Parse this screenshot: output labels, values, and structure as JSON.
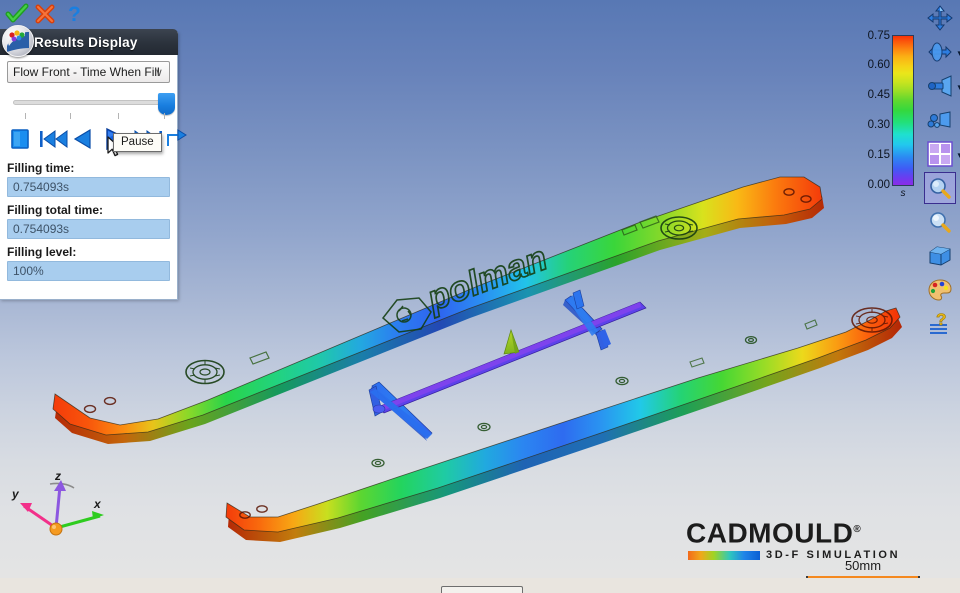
{
  "window": {
    "top_icons": [
      {
        "name": "ok-icon",
        "label": "OK"
      },
      {
        "name": "cancel-icon",
        "label": "Cancel"
      },
      {
        "name": "help-icon",
        "label": "Help"
      }
    ]
  },
  "panel": {
    "title": "Results Display",
    "icon": "results-display-icon",
    "result_type": {
      "selected": "Flow Front - Time When Fill",
      "arrow": "∨"
    },
    "timeline": {
      "position_percent": 100,
      "tick_count": 4
    },
    "playback": [
      {
        "name": "stop-button",
        "label": "Stop"
      },
      {
        "name": "first-frame-button",
        "label": "First"
      },
      {
        "name": "previous-frame-button",
        "label": "Previous"
      },
      {
        "name": "play-button",
        "label": "Play"
      },
      {
        "name": "next-frame-button",
        "label": "Next"
      },
      {
        "name": "loop-button",
        "label": "Loop"
      }
    ],
    "tooltip": "Pause",
    "fields": [
      {
        "label": "Filling time:",
        "value": "0.754093s"
      },
      {
        "label": "Filling total time:",
        "value": "0.754093s"
      },
      {
        "label": "Filling level:",
        "value": "100%"
      }
    ]
  },
  "legend": {
    "unit": "s",
    "ticks": [
      "0.75",
      "0.60",
      "0.45",
      "0.30",
      "0.15",
      "0.00"
    ],
    "min": 0.0,
    "max": 0.75,
    "colors_low_to_high": [
      "#8b2ce8",
      "#2b8cf2",
      "#22c8ee",
      "#34d83e",
      "#eae61a",
      "#fb8710",
      "#f93207"
    ]
  },
  "toolbar": [
    {
      "name": "pan-tool-icon",
      "label": "Pan",
      "dropdown": false,
      "selected": false
    },
    {
      "name": "rotate-tool-icon",
      "label": "Rotate",
      "dropdown": true,
      "selected": false
    },
    {
      "name": "light-tool-icon",
      "label": "Light",
      "dropdown": true,
      "selected": false
    },
    {
      "name": "spray-tool-icon",
      "label": "Spray",
      "dropdown": false,
      "selected": false
    },
    {
      "name": "layout-grid-icon",
      "label": "Layout",
      "dropdown": true,
      "selected": false
    },
    {
      "name": "zoom-box-icon",
      "label": "Zoom Box",
      "dropdown": false,
      "selected": true
    },
    {
      "name": "zoom-icon",
      "label": "Zoom",
      "dropdown": false,
      "selected": false
    },
    {
      "name": "solid-view-icon",
      "label": "Solid View",
      "dropdown": false,
      "selected": false
    },
    {
      "name": "palette-icon",
      "label": "Colors",
      "dropdown": false,
      "selected": false
    },
    {
      "name": "help-doc-icon",
      "label": "Help",
      "dropdown": false,
      "selected": false
    }
  ],
  "axis_triad": {
    "x": "x",
    "y": "y",
    "z": "z",
    "x_color": "#2ecc1f",
    "y_color": "#f2308a",
    "z_color": "#8c57e0"
  },
  "branding": {
    "title": "CADMOULD",
    "registered": "®",
    "subtitle": "3D-F SIMULATION"
  },
  "scale": {
    "label": "50mm"
  },
  "model": {
    "emboss_text": "polman",
    "gate_label": "injection-gate"
  }
}
